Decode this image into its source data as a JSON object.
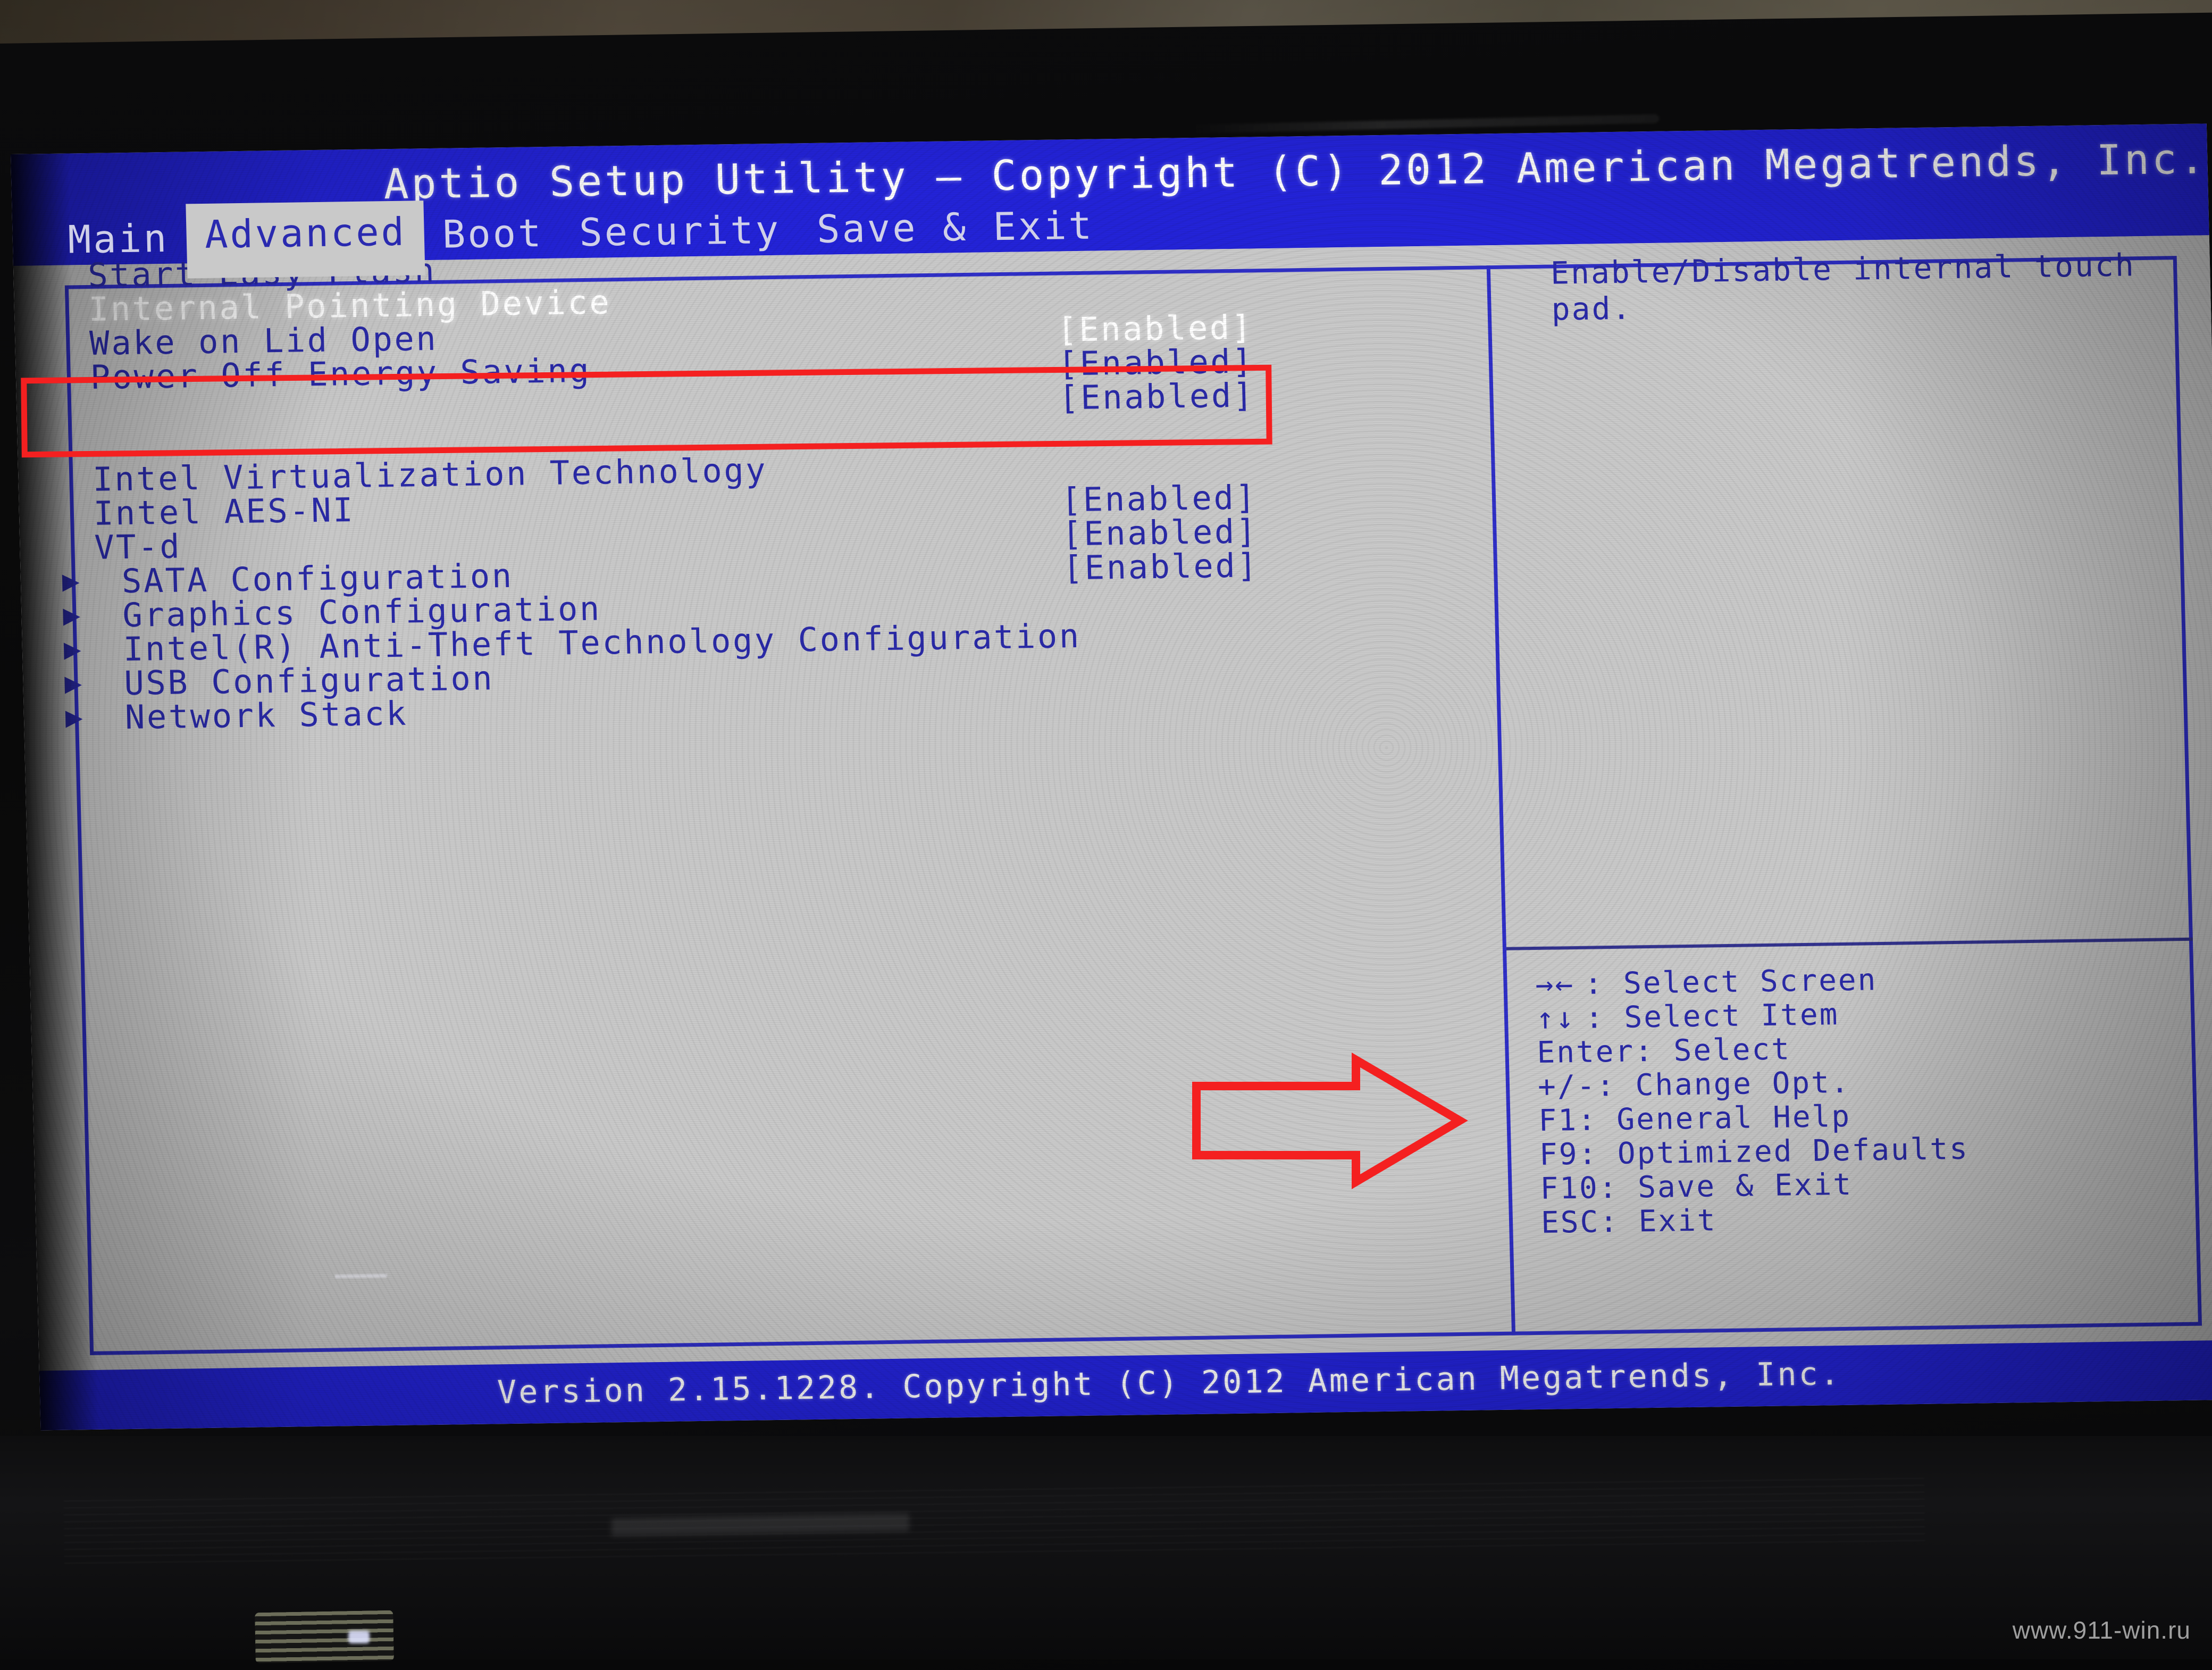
{
  "window": {
    "title": "Aptio Setup Utility – Copyright (C) 2012 American Megatrends, Inc.",
    "footer_version": "Version 2.15.1228. Copyright (C) 2012 American Megatrends, Inc."
  },
  "tabs": [
    {
      "label": "Main",
      "active": false
    },
    {
      "label": "Advanced",
      "active": true
    },
    {
      "label": "Boot",
      "active": false
    },
    {
      "label": "Security",
      "active": false
    },
    {
      "label": "Save & Exit",
      "active": false
    }
  ],
  "settings": [
    {
      "label": "Start Easy Flash",
      "value": "",
      "submenu": false,
      "selected": false
    },
    {
      "label": "Internal Pointing Device",
      "value": "",
      "submenu": false,
      "selected": true
    },
    {
      "label": "Wake on Lid Open",
      "value": "[Enabled]",
      "submenu": false,
      "selected": false
    },
    {
      "label": "Power Off Energy Saving",
      "value": "[Enabled]",
      "submenu": false,
      "selected": false
    },
    {
      "label": "",
      "value": "[Enabled]",
      "submenu": false,
      "selected": false
    },
    {
      "label": "Intel Virtualization Technology",
      "value": "",
      "submenu": false,
      "selected": false
    },
    {
      "label": "Intel AES-NI",
      "value": "[Enabled]",
      "submenu": false,
      "selected": false
    },
    {
      "label": "VT-d",
      "value": "[Enabled]",
      "submenu": false,
      "selected": false
    },
    {
      "label": "SATA Configuration",
      "value": "[Enabled]",
      "submenu": true,
      "selected": false
    },
    {
      "label": "Graphics Configuration",
      "value": "",
      "submenu": true,
      "selected": false
    },
    {
      "label": "Intel(R) Anti-Theft Technology Configuration",
      "value": "",
      "submenu": true,
      "selected": false
    },
    {
      "label": "USB Configuration",
      "value": "",
      "submenu": true,
      "selected": false
    },
    {
      "label": "Network Stack",
      "value": "",
      "submenu": true,
      "selected": false
    }
  ],
  "help": {
    "text": "Enable/Disable internal touch pad."
  },
  "legend": [
    {
      "key": "→←",
      "desc": ": Select Screen"
    },
    {
      "key": "↑↓",
      "desc": ": Select Item"
    },
    {
      "key": "Enter",
      "desc": ": Select"
    },
    {
      "key": "+/-",
      "desc": ": Change Opt."
    },
    {
      "key": "F1",
      "desc": ": General Help"
    },
    {
      "key": "F9",
      "desc": ": Optimized Defaults"
    },
    {
      "key": "F10",
      "desc": ": Save & Exit"
    },
    {
      "key": "ESC",
      "desc": ": Exit"
    }
  ],
  "annotations": {
    "highlight_box_target": "Internal Pointing Device / Wake on Lid Open",
    "arrow_target": "F10: Save & Exit",
    "color": "#f42020"
  },
  "watermark": "www.911-win.ru",
  "colors": {
    "screen_bg": "#c9c9c9",
    "bar_blue": "#2323d8",
    "text_blue": "#2a2aa8",
    "selected_text": "#ffffff",
    "annotation_red": "#f42020"
  }
}
